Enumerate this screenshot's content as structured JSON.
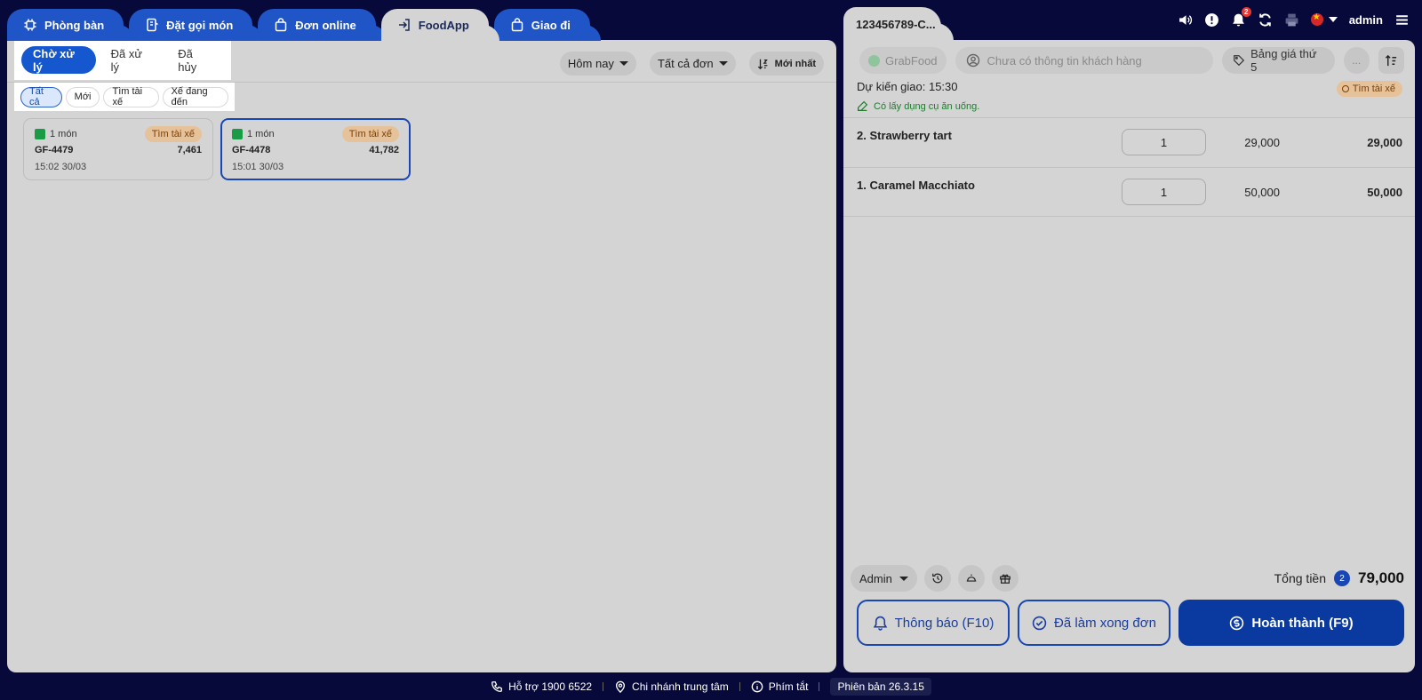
{
  "tabs": [
    {
      "label": "Phòng bàn",
      "icon": "table-icon"
    },
    {
      "label": "Đặt gọi món",
      "icon": "order-icon"
    },
    {
      "label": "Đơn online",
      "icon": "bag-icon"
    },
    {
      "label": "FoodApp",
      "icon": "login-icon",
      "active": true
    },
    {
      "label": "Giao đi",
      "icon": "bag-icon"
    }
  ],
  "left": {
    "status_tabs": [
      "Chờ xử lý",
      "Đã xử lý",
      "Đã hủy"
    ],
    "filters": [
      "Tất cả",
      "Mới",
      "Tìm tài xế",
      "Xế đang đến"
    ],
    "date_filter": "Hôm nay",
    "type_filter": "Tất cả đơn",
    "sort_label": "Mới nhất",
    "orders": [
      {
        "items": "1 món",
        "status": "Tìm tài xế",
        "code": "GF-4479",
        "amount": "7,461",
        "time": "15:02 30/03"
      },
      {
        "items": "1 món",
        "status": "Tìm tài xế",
        "code": "GF-4478",
        "amount": "41,782",
        "time": "15:01 30/03"
      }
    ]
  },
  "right": {
    "order_tab": "123456789-C...",
    "header": {
      "notification_count": "2",
      "user": "admin"
    },
    "source": "GrabFood",
    "customer_placeholder": "Chưa có thông tin khách hàng",
    "price_list": "Bảng giá thứ 5",
    "more": "...",
    "eta": "Dự kiến giao: 15:30",
    "eta_status": "Tìm tài xế",
    "utensils": "Có lấy dụng cụ ăn uống.",
    "items": [
      {
        "name": "2. Strawberry tart",
        "qty": "1",
        "price": "29,000",
        "total": "29,000"
      },
      {
        "name": "1. Caramel Macchiato",
        "qty": "1",
        "price": "50,000",
        "total": "50,000"
      }
    ],
    "staff": "Admin",
    "total_label": "Tổng tiền",
    "total_count": "2",
    "total_value": "79,000",
    "buttons": {
      "notify": "Thông báo (F10)",
      "done": "Đã làm xong đơn",
      "complete": "Hoàn thành (F9)"
    }
  },
  "footer": {
    "support": "Hỗ trợ 1900 6522",
    "branch": "Chi nhánh trung tâm",
    "shortcuts": "Phím tắt",
    "version": "Phiên bản 26.3.15"
  }
}
